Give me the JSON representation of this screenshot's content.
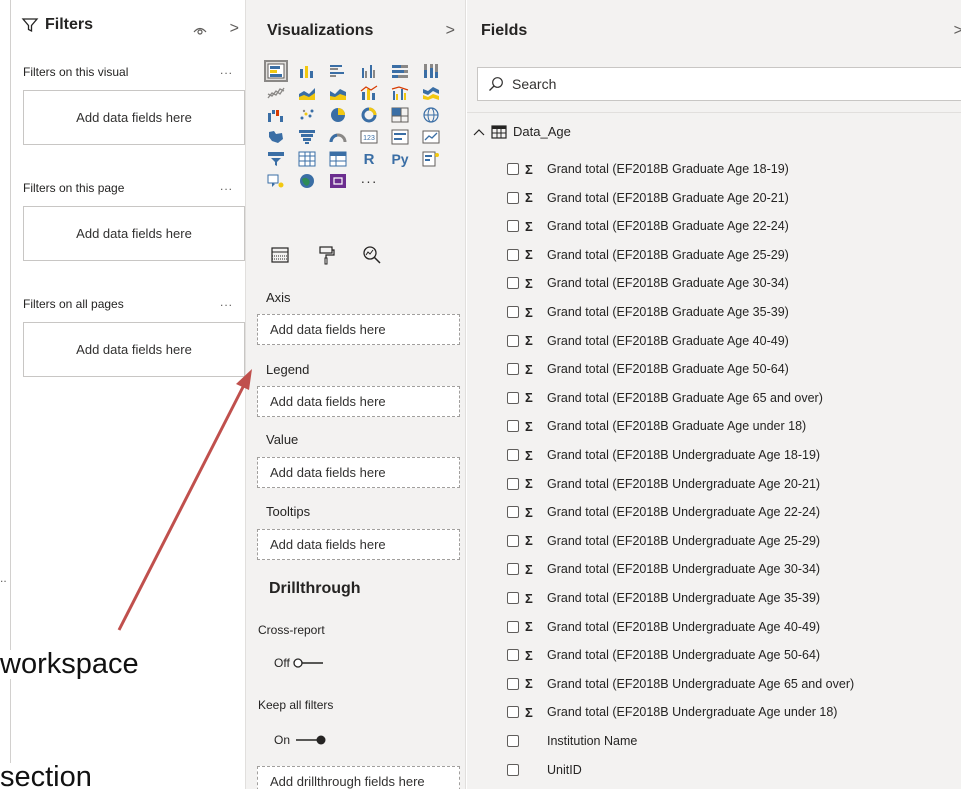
{
  "filters": {
    "title": "Filters",
    "sections": [
      {
        "label": "Filters on this visual",
        "more": "...",
        "box": "Add data fields here"
      },
      {
        "label": "Filters on this page",
        "more": "...",
        "box": "Add data fields here"
      },
      {
        "label": "Filters on all pages",
        "more": "...",
        "box": "Add data fields here"
      }
    ]
  },
  "slide": {
    "ellipsis": ".."
  },
  "visualizations": {
    "title": "Visualizations",
    "chevron": ">",
    "grid_text": {
      "r": "R",
      "py": "Py",
      "more": "···"
    },
    "wells": [
      {
        "label": "Axis",
        "placeholder": "Add data fields here"
      },
      {
        "label": "Legend",
        "placeholder": "Add data fields here"
      },
      {
        "label": "Value",
        "placeholder": "Add data fields here"
      },
      {
        "label": "Tooltips",
        "placeholder": "Add data fields here"
      }
    ],
    "drillthrough": {
      "title": "Drillthrough",
      "cross_report_label": "Cross-report",
      "cross_report_state": "Off",
      "keep_filters_label": "Keep all filters",
      "keep_filters_state": "On",
      "drill_placeholder": "Add drillthrough fields here"
    }
  },
  "fields": {
    "title": "Fields",
    "chevron": ">",
    "search_placeholder": "Search",
    "table_name": "Data_Age",
    "items": [
      {
        "sigma": "Σ",
        "label": "Grand total (EF2018B Graduate Age 18-19)"
      },
      {
        "sigma": "Σ",
        "label": "Grand total (EF2018B Graduate Age 20-21)"
      },
      {
        "sigma": "Σ",
        "label": "Grand total (EF2018B Graduate Age 22-24)"
      },
      {
        "sigma": "Σ",
        "label": "Grand total (EF2018B Graduate Age 25-29)"
      },
      {
        "sigma": "Σ",
        "label": "Grand total (EF2018B Graduate Age 30-34)"
      },
      {
        "sigma": "Σ",
        "label": "Grand total (EF2018B Graduate Age 35-39)"
      },
      {
        "sigma": "Σ",
        "label": "Grand total (EF2018B Graduate Age 40-49)"
      },
      {
        "sigma": "Σ",
        "label": "Grand total (EF2018B Graduate Age 50-64)"
      },
      {
        "sigma": "Σ",
        "label": "Grand total (EF2018B Graduate Age 65 and over)"
      },
      {
        "sigma": "Σ",
        "label": "Grand total (EF2018B Graduate Age under 18)"
      },
      {
        "sigma": "Σ",
        "label": "Grand total (EF2018B Undergraduate Age 18-19)"
      },
      {
        "sigma": "Σ",
        "label": "Grand total (EF2018B Undergraduate Age 20-21)"
      },
      {
        "sigma": "Σ",
        "label": "Grand total (EF2018B Undergraduate Age 22-24)"
      },
      {
        "sigma": "Σ",
        "label": "Grand total (EF2018B Undergraduate Age 25-29)"
      },
      {
        "sigma": "Σ",
        "label": "Grand total (EF2018B Undergraduate Age 30-34)"
      },
      {
        "sigma": "Σ",
        "label": "Grand total (EF2018B Undergraduate Age 35-39)"
      },
      {
        "sigma": "Σ",
        "label": "Grand total (EF2018B Undergraduate Age 40-49)"
      },
      {
        "sigma": "Σ",
        "label": "Grand total (EF2018B Undergraduate Age 50-64)"
      },
      {
        "sigma": "Σ",
        "label": "Grand total (EF2018B Undergraduate Age 65 and over)"
      },
      {
        "sigma": "Σ",
        "label": "Grand total (EF2018B Undergraduate Age under 18)"
      },
      {
        "sigma": "",
        "label": "Institution Name"
      },
      {
        "sigma": "",
        "label": "UnitID"
      }
    ]
  },
  "annotation": {
    "text_workspace": "workspace",
    "text_section": "section",
    "arrow_color": "#c0504d"
  },
  "colors": {
    "accent_yellow": "#f2c811",
    "pane_bg": "#f3f2f1",
    "icon_blue": "#3a6ea5"
  }
}
